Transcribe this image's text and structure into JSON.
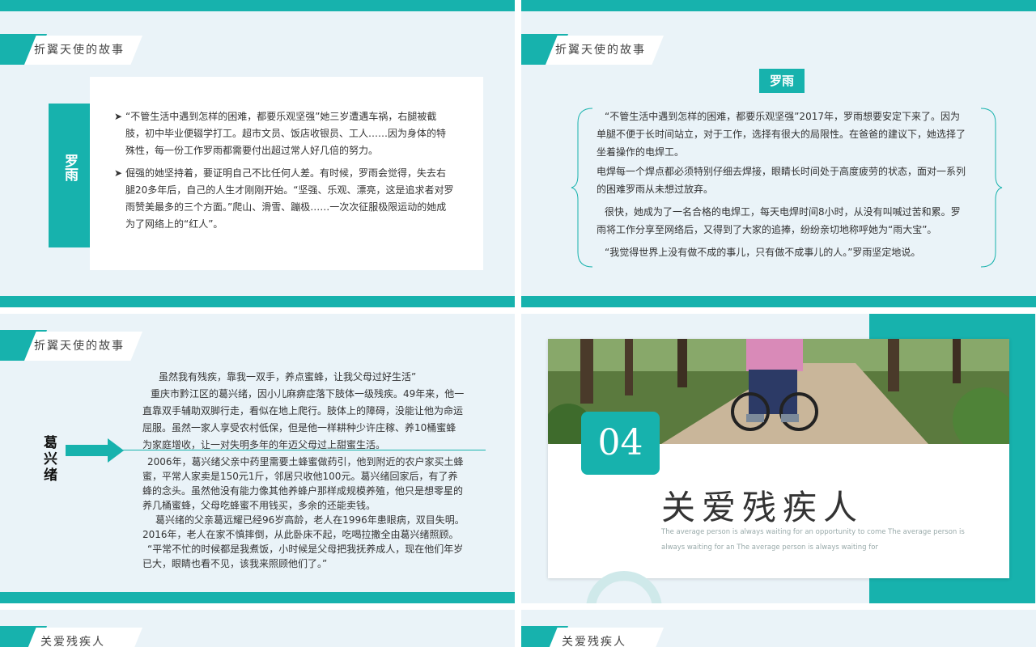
{
  "colors": {
    "accent": "#17b2ad",
    "background": "#eaf3f8"
  },
  "slide1": {
    "tag": "折翼天使的故事",
    "side_label": "罗雨",
    "bullets": [
      "“不管生活中遇到怎样的困难，都要乐观坚强”她三岁遭遇车祸，右腿被截肢，初中毕业便辍学打工。超市文员、饭店收银员、工人……因为身体的特殊性，每一份工作罗雨都需要付出超过常人好几倍的努力。",
      "倔强的她坚持着，要证明自己不比任何人差。有时候，罗雨会觉得，失去右腿20多年后，自己的人生才刚刚开始。“坚强、乐观、漂亮，这是追求者对罗雨赞美最多的三个方面。”爬山、滑雪、蹦极……一次次征服极限运动的她成为了网络上的“红人”。"
    ]
  },
  "slide2": {
    "tag": "折翼天使的故事",
    "name": "罗雨",
    "paragraphs": [
      "“不管生活中遇到怎样的困难，都要乐观坚强”2017年，罗雨想要安定下来了。因为单腿不便于长时间站立，对于工作，选择有很大的局限性。在爸爸的建议下，她选择了坐着操作的电焊工。",
      "电焊每一个焊点都必须特别仔细去焊接，眼睛长时间处于高度疲劳的状态，面对一系列的困难罗雨从未想过放弃。",
      "很快，她成为了一名合格的电焊工，每天电焊时间8小时，从没有叫喊过苦和累。罗雨将工作分享至网络后，又得到了大家的追捧，纷纷亲切地称呼她为“雨大宝”。",
      "“我觉得世界上没有做不成的事儿，只有做不成事儿的人。”罗雨坚定地说。"
    ]
  },
  "slide3": {
    "tag": "折翼天使的故事",
    "name": "葛兴绪",
    "top_paragraphs": [
      "虽然我有残疾，靠我一双手，养点蜜蜂，让我父母过好生活”",
      "重庆市黔江区的葛兴绪，因小儿麻痹症落下肢体一级残疾。49年来，他一直靠双手辅助双脚行走，看似在地上爬行。肢体上的障碍，没能让他为命运屈服。虽然一家人享受农村低保，但是他一样耕种少许庄稼、养10桶蜜蜂为家庭增收，让一对失明多年的年迈父母过上甜蜜生活。"
    ],
    "bottom_paragraphs": [
      "2006年，葛兴绪父亲中药里需要土蜂蜜做药引，他到附近的农户家买土蜂蜜，平常人家卖是150元1斤，邻居只收他100元。葛兴绪回家后，有了养蜂的念头。虽然他没有能力像其他养蜂户那样成规模养殖，他只是想零星的养几桶蜜蜂，父母吃蜂蜜不用钱买，多余的还能卖钱。",
      "葛兴绪的父亲葛远耀已经96岁高龄，老人在1996年患眼病，双目失明。2016年，老人在家不慎摔倒，从此卧床不起，吃喝拉撒全由葛兴绪照顾。",
      "“平常不忙的时候都是我煮饭，小时候是父母把我抚养成人，现在他们年岁已大，眼睛也看不见，该我来照顾他们了。”"
    ]
  },
  "slide4": {
    "number": "04",
    "title": "关爱残疾人",
    "subtitle": "The average person is always waiting for an opportunity to come The average person is always waiting for an The average person is always waiting for"
  },
  "slide5": {
    "tag": "关爱残疾人"
  },
  "slide6": {
    "tag": "关爱残疾人"
  }
}
